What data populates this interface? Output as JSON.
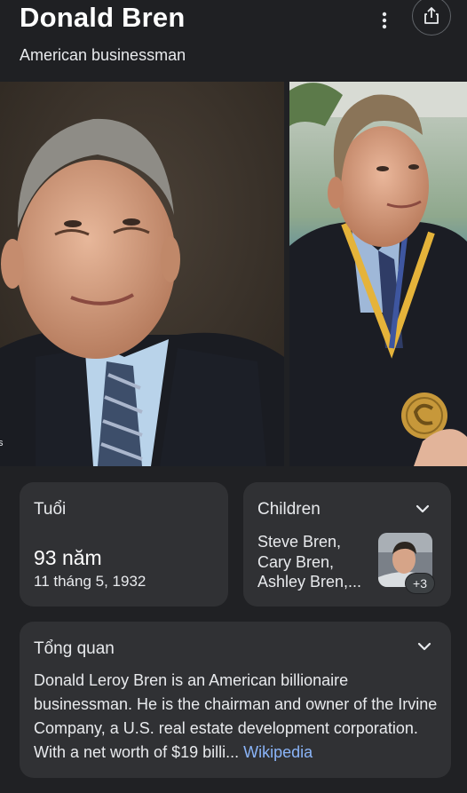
{
  "header": {
    "title": "Donald Bren",
    "subtitle": "American businessman",
    "more_icon": "more-vert-icon",
    "share_icon": "share-icon"
  },
  "age_card": {
    "label": "Tuổi",
    "value": "93 năm",
    "birth_date": "11 tháng 5, 1932"
  },
  "children_card": {
    "label": "Children",
    "names": [
      "Steve Bren,",
      "Cary Bren,",
      "Ashley Bren,..."
    ],
    "more_count": "+3"
  },
  "overview_card": {
    "label": "Tổng quan",
    "text": "Donald Leroy Bren is an American billionaire businessman. He is the chairman and owner of the Irvine Company, a U.S. real estate development corporation. With a net worth of $19 billi...",
    "source_link": "Wikipedia"
  },
  "colors": {
    "background": "#202124",
    "card": "#303134",
    "link": "#8ab4f8"
  }
}
